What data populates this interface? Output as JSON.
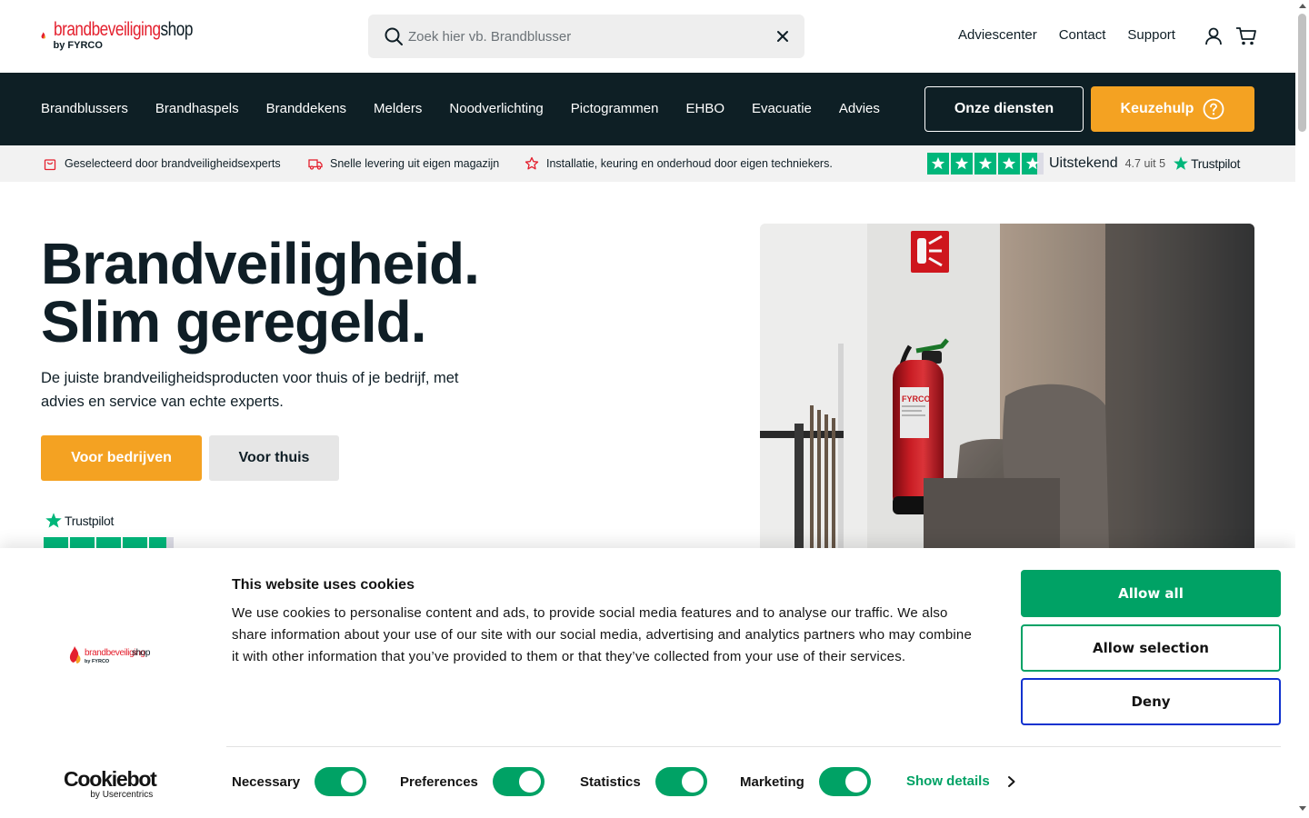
{
  "logo": {
    "part1": "brandbeveiliging",
    "part2": "shop",
    "byline": "by FYRCO"
  },
  "search": {
    "placeholder": "Zoek hier vb. Brandblusser",
    "value": ""
  },
  "topnav": [
    "Adviescenter",
    "Contact",
    "Support"
  ],
  "mainnav": {
    "categories": [
      "Brandblussers",
      "Brandhaspels",
      "Branddekens",
      "Melders",
      "Noodverlichting",
      "Pictogrammen",
      "EHBO",
      "Evacuatie",
      "Advies"
    ],
    "services_button": "Onze diensten",
    "help_button": "Keuzehulp"
  },
  "usp": [
    {
      "icon": "bag-icon",
      "text": "Geselecteerd door brandveiligheidsexperts"
    },
    {
      "icon": "truck-icon",
      "text": "Snelle levering uit eigen magazijn"
    },
    {
      "icon": "star-outline-icon",
      "text": "Installatie, keuring en onderhoud door eigen techniekers."
    }
  ],
  "trustpilot": {
    "rating_word": "Uitstekend",
    "score": "4.7 uit 5",
    "brand": "Trustpilot",
    "stars": 4.7
  },
  "hero": {
    "title_line1": "Brandveiligheid.",
    "title_line2": "Slim geregeld.",
    "subtitle": "De juiste brandveiligheidsproducten voor thuis of je bedrijf, met advies en service van echte experts.",
    "btn_business": "Voor bedrijven",
    "btn_home": "Voor thuis",
    "trustpilot_brand": "Trustpilot",
    "extinguisher_brand": "FYRCO"
  },
  "cookie": {
    "title": "This website uses cookies",
    "text": "We use cookies to personalise content and ads, to provide social media features and to analyse our traffic. We also share information about your use of our site with our social media, advertising and analytics partners who may combine it with other information that you’ve provided to them or that they’ve collected from your use of their services.",
    "allow_all": "Allow all",
    "allow_selection": "Allow selection",
    "deny": "Deny",
    "toggles": [
      {
        "label": "Necessary",
        "on": true
      },
      {
        "label": "Preferences",
        "on": true
      },
      {
        "label": "Statistics",
        "on": true
      },
      {
        "label": "Marketing",
        "on": true
      }
    ],
    "show_details": "Show details",
    "cookiebot_name": "Cookiebot",
    "cookiebot_by": "by Usercentrics"
  },
  "colors": {
    "navy": "#0e1f25",
    "orange": "#f4a222",
    "brand_red": "#e4202e",
    "cookie_green": "#00a265",
    "deny_blue": "#1032cf",
    "trustpilot_green": "#00b67a"
  }
}
